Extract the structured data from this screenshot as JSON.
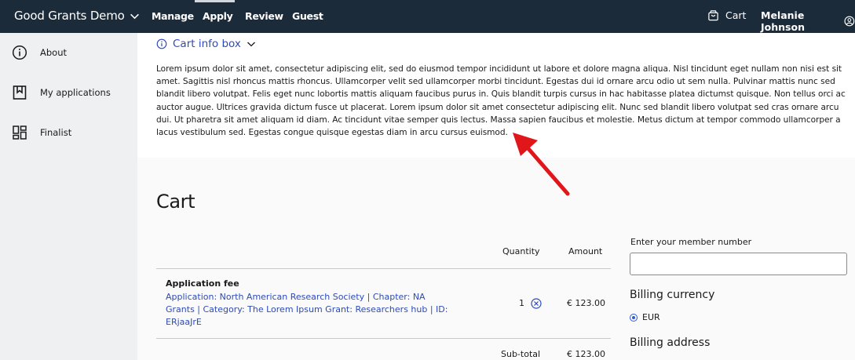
{
  "header": {
    "brand": "Good Grants Demo",
    "nav": [
      {
        "label": "Manage"
      },
      {
        "label": "Apply"
      },
      {
        "label": "Review"
      },
      {
        "label": "Guest"
      }
    ],
    "active_nav": "Apply",
    "cart_label": "Cart",
    "user_name": "Melanie Johnson"
  },
  "sidebar": {
    "items": [
      {
        "label": "About",
        "icon": "info-circle-icon"
      },
      {
        "label": "My applications",
        "icon": "bookmark-icon"
      },
      {
        "label": "Finalist",
        "icon": "grid-icon"
      }
    ]
  },
  "info_box": {
    "title": "Cart info box",
    "text": "Lorem ipsum dolor sit amet, consectetur adipiscing elit, sed do eiusmod tempor incididunt ut labore et dolore magna aliqua. Nisl tincidunt eget nullam non nisi est sit amet. Sagittis nisl rhoncus mattis rhoncus. Ullamcorper velit sed ullamcorper morbi tincidunt. Egestas dui id ornare arcu odio ut sem nulla. Pulvinar mattis nunc sed blandit libero volutpat. Felis eget nunc lobortis mattis aliquam faucibus purus in. Quis blandit turpis cursus in hac habitasse platea dictumst quisque. Non tellus orci ac auctor augue. Ultrices gravida dictum fusce ut placerat. Lorem ipsum dolor sit amet consectetur adipiscing elit. Nunc sed blandit libero volutpat sed cras ornare arcu dui. Ut pharetra sit amet aliquam id diam. Ac tincidunt vitae semper quis lectus. Massa sapien faucibus et molestie. Metus dictum at tempor commodo ullamcorper a lacus vestibulum sed. Egestas congue quisque egestas diam in arcu cursus euismod."
  },
  "cart": {
    "title": "Cart",
    "columns": {
      "quantity": "Quantity",
      "amount": "Amount"
    },
    "items": [
      {
        "name": "Application fee",
        "description": "Application: North American Research Society | Chapter: NA Grants | Category: The Lorem Ipsum Grant: Researchers hub | ID: ERjaaJrE",
        "quantity": "1",
        "amount": "€ 123.00"
      }
    ],
    "subtotal_label": "Sub-total",
    "subtotal_value": "€ 123.00"
  },
  "billing": {
    "member_label": "Enter your member number",
    "member_value": "",
    "currency_heading": "Billing currency",
    "currency_option": "EUR",
    "address_heading": "Billing address"
  },
  "colors": {
    "topbar": "#1c2b3a",
    "link": "#2e4bb8",
    "annotation_arrow": "#e0161b"
  }
}
